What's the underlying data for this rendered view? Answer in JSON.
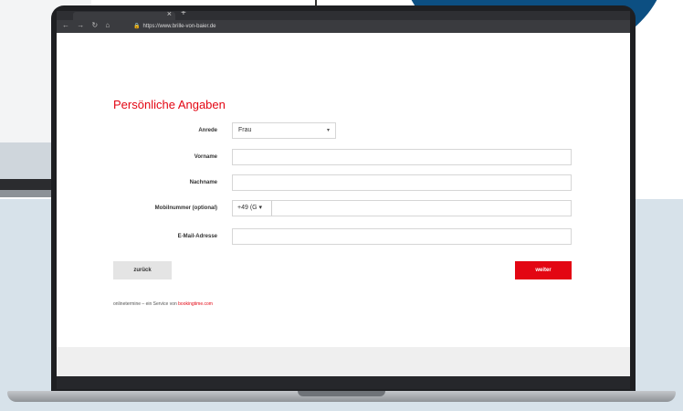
{
  "browser": {
    "url": "https://www.brille-von-baier.de",
    "tab_close": "×",
    "new_tab": "+",
    "nav_icons": "← → ↻ ⌂"
  },
  "form": {
    "title": "Persönliche Angaben",
    "fields": [
      {
        "label": "Anrede",
        "type": "select",
        "value": "Frau"
      },
      {
        "label": "Vorname",
        "type": "text",
        "value": ""
      },
      {
        "label": "Nachname",
        "type": "text",
        "value": ""
      },
      {
        "label": "Mobilnummer (optional)",
        "type": "phone",
        "prefix": "+49 (G ▾",
        "value": ""
      },
      {
        "label": "E-Mail-Adresse",
        "type": "text",
        "value": ""
      }
    ],
    "back_label": "zurück",
    "next_label": "weiter"
  },
  "footer": {
    "text": "onlinetermine – ein Service von ",
    "brand": "bookingtime.com"
  },
  "colors": {
    "accent_red": "#e30613",
    "circle_blue": "#0c4f82",
    "panel_blue": "#d7e2ea"
  }
}
